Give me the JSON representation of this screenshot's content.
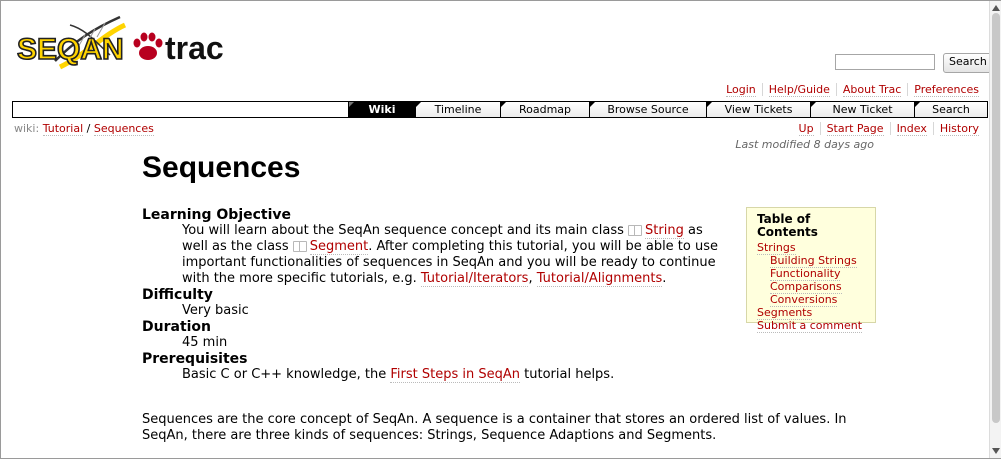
{
  "header": {
    "logo_text_left": "SEQAN",
    "logo_text_right": "trac",
    "search_button": "Search"
  },
  "metanav": [
    "Login",
    "Help/Guide",
    "About Trac",
    "Preferences"
  ],
  "mainnav": [
    "Wiki",
    "Timeline",
    "Roadmap",
    "Browse Source",
    "View Tickets",
    "New Ticket",
    "Search"
  ],
  "mainnav_active": "Wiki",
  "breadcrumb": {
    "prefix": "wiki:",
    "items": [
      "Tutorial",
      "/",
      "Sequences"
    ]
  },
  "ctxtnav": [
    "Up",
    "Start Page",
    "Index",
    "History"
  ],
  "last_modified": "Last modified 8 days ago",
  "page_title": "Sequences",
  "definitions": {
    "learning_objective": {
      "term": "Learning Objective",
      "t1": "You will learn about the SeqAn sequence concept and its main class ",
      "link_string": "String",
      "t2": " as well as the class ",
      "link_segment": "Segment",
      "t3": ". After completing this tutorial, you will be able to use important functionalities of sequences in SeqAn and you will be ready to continue with the more specific tutorials, e.g. ",
      "link_iterators": "Tutorial/Iterators",
      "t4": ", ",
      "link_alignments": "Tutorial/Alignments",
      "t5": "."
    },
    "difficulty": {
      "term": "Difficulty",
      "value": "Very basic"
    },
    "duration": {
      "term": "Duration",
      "value": "45 min"
    },
    "prerequisites": {
      "term": "Prerequisites",
      "t1": "Basic C or C++ knowledge, the ",
      "link": "First Steps in SeqAn",
      "t2": " tutorial helps."
    }
  },
  "intro_paragraph": "Sequences are the core concept of SeqAn. A sequence is a container that stores an ordered list of values. In SeqAn, there are three kinds of sequences: Strings, Sequence Adaptions and Segments.",
  "toc": {
    "title": "Table of Contents",
    "items": [
      {
        "label": "Strings",
        "level": 1
      },
      {
        "label": "Building Strings",
        "level": 2
      },
      {
        "label": "Functionality",
        "level": 2
      },
      {
        "label": "Comparisons",
        "level": 2
      },
      {
        "label": "Conversions",
        "level": 2
      },
      {
        "label": "Segments",
        "level": 1
      },
      {
        "label": "Submit a comment",
        "level": 1
      }
    ]
  },
  "colors": {
    "link": "#b00000",
    "toc_bg": "#ffffdd",
    "logo_yellow": "#ffd400",
    "logo_red": "#b8001f"
  }
}
